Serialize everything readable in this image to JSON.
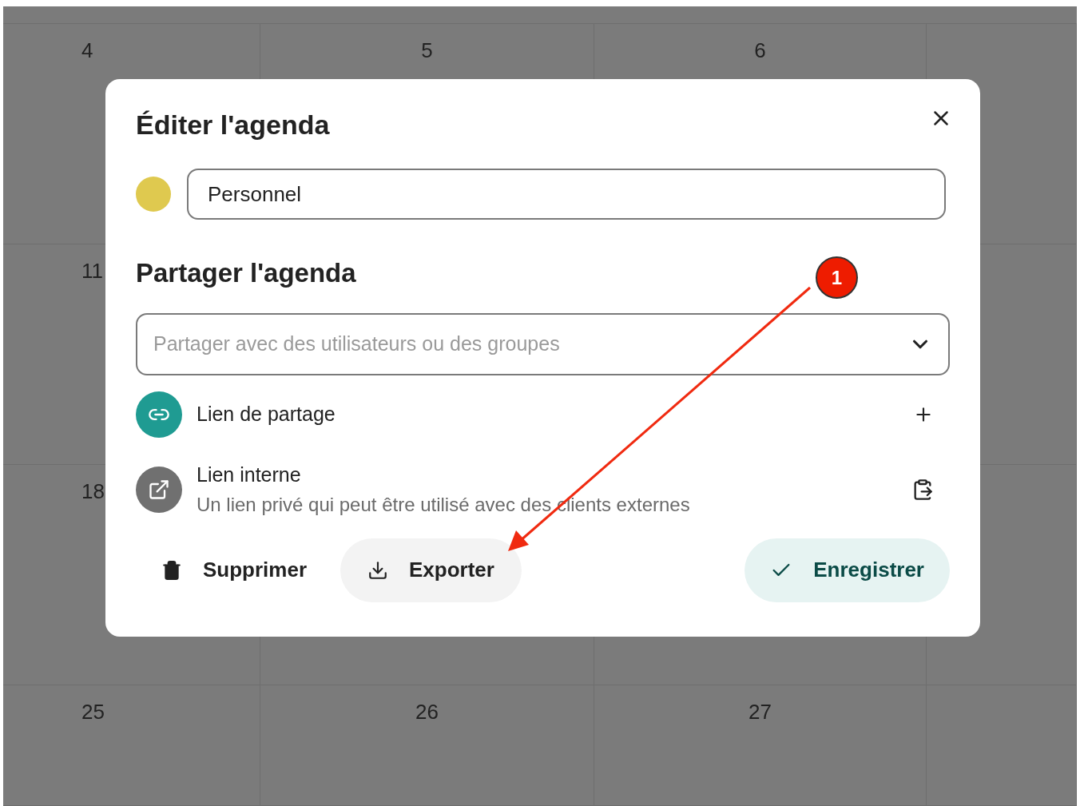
{
  "calendar": {
    "rows": [
      {
        "cells": [
          "4",
          "5",
          "6"
        ]
      },
      {
        "cells": [
          "11"
        ]
      },
      {
        "cells": [
          "18"
        ]
      },
      {
        "cells": [
          "25",
          "26",
          "27"
        ]
      }
    ]
  },
  "dialog": {
    "title": "Éditer l'agenda",
    "color": "#dfc94f",
    "name_field": {
      "value": "Personnel"
    },
    "share_heading": "Partager l'agenda",
    "share_select": {
      "placeholder": "Partager avec des utilisateurs ou des groupes"
    },
    "links": [
      {
        "kind": "share",
        "label": "Lien de partage"
      },
      {
        "kind": "internal",
        "label": "Lien interne",
        "description": "Un lien privé qui peut être utilisé avec des clients externes"
      }
    ],
    "buttons": [
      {
        "kind": "delete",
        "label": "Supprimer"
      },
      {
        "kind": "export",
        "label": "Exporter"
      },
      {
        "kind": "save",
        "label": "Enregistrer"
      }
    ]
  },
  "annotation": {
    "number": "1"
  }
}
